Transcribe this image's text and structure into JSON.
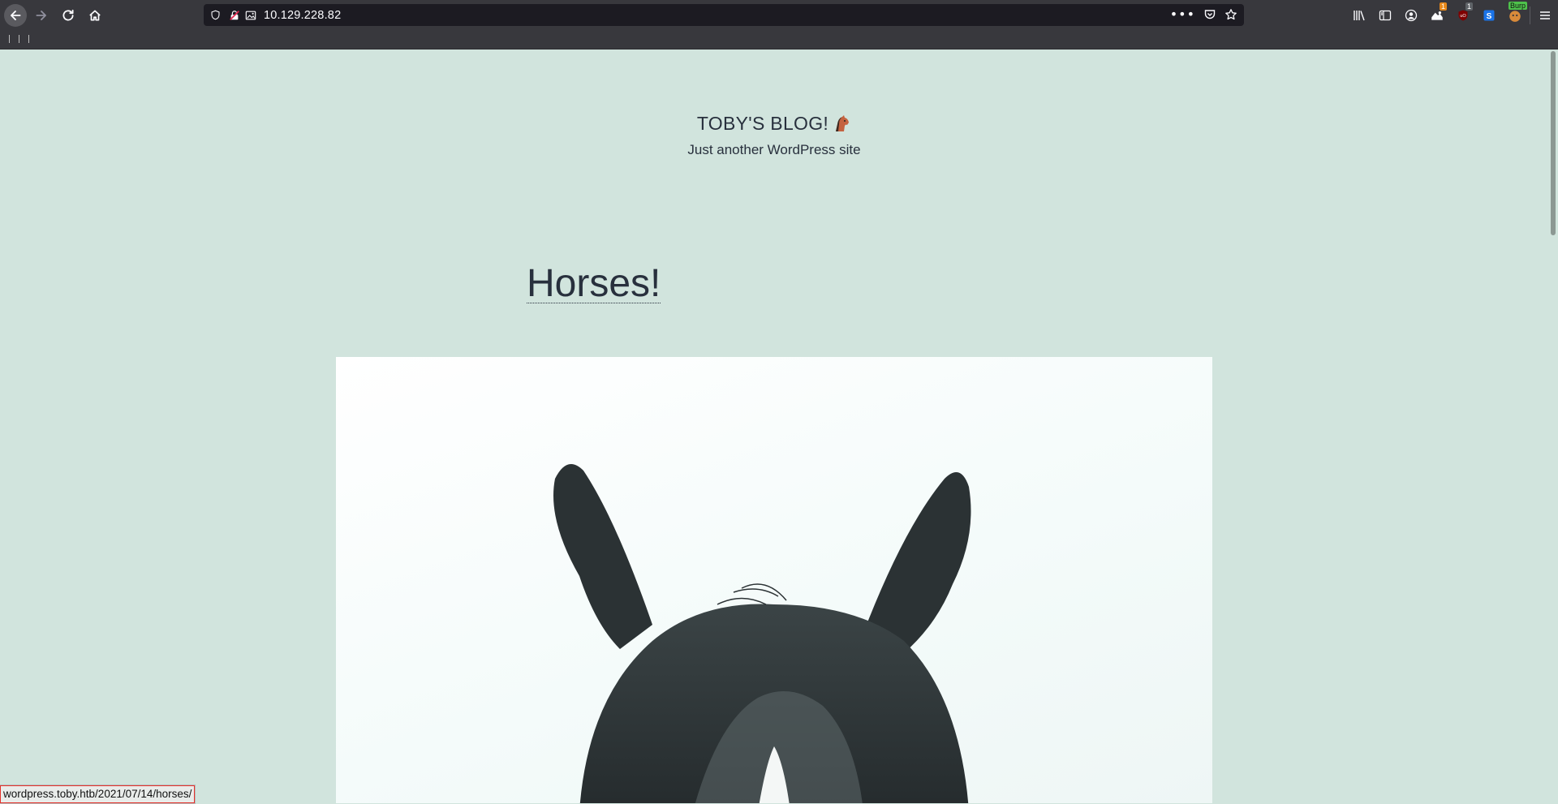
{
  "browser": {
    "url": "10.129.228.82",
    "status_url": "wordpress.toby.htb/2021/07/14/horses/",
    "badges": {
      "extension_count": "1",
      "ublock_count": "1",
      "burp_label": "Burp"
    }
  },
  "site": {
    "title": "TOBY'S BLOG!",
    "tagline": "Just another WordPress site"
  },
  "post": {
    "title": "Horses!"
  },
  "colors": {
    "page_bg": "#d1e4dd",
    "text": "#28303d",
    "chrome": "#38383d",
    "urlbar": "#1c1b22"
  },
  "icons": {
    "back": "back-arrow-icon",
    "forward": "forward-arrow-icon",
    "reload": "reload-icon",
    "home": "home-icon",
    "site_emoji": "horse-face-emoji"
  }
}
